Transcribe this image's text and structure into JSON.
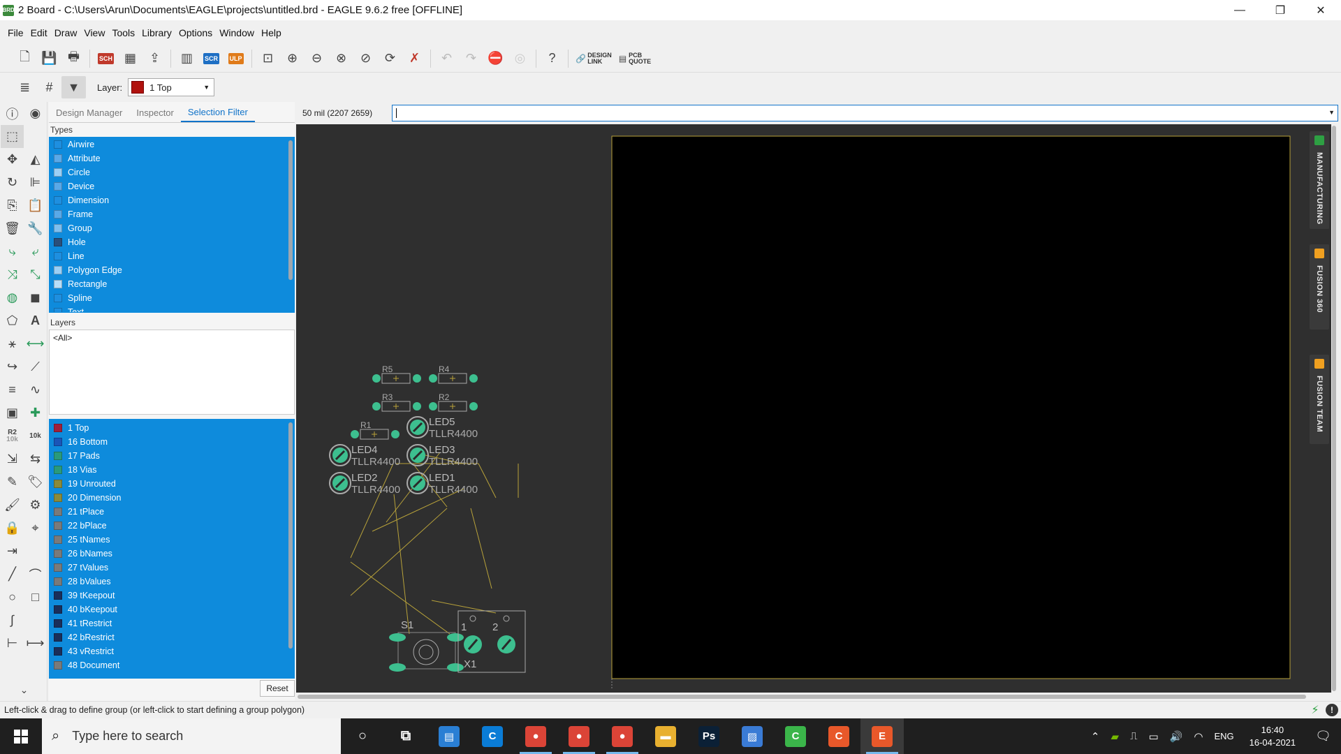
{
  "window": {
    "title": "2 Board - C:\\Users\\Arun\\Documents\\EAGLE\\projects\\untitled.brd - EAGLE 9.6.2 free [OFFLINE]",
    "app_icon_text": "BRD",
    "minimize": "—",
    "restore": "❐",
    "close": "✕"
  },
  "menu": [
    "File",
    "Edit",
    "Draw",
    "View",
    "Tools",
    "Library",
    "Options",
    "Window",
    "Help"
  ],
  "toolbar": {
    "scr_label": "SCR",
    "ulp_label": "ULP",
    "design_link": [
      "DESIGN",
      "LINK"
    ],
    "pcb_quote": [
      "PCB",
      "QUOTE"
    ],
    "help_glyph": "?"
  },
  "layerbar": {
    "label": "Layer:",
    "selected_layer": "1 Top",
    "swatch_color": "#b0120e"
  },
  "tool_labels": {
    "r2": "R2",
    "r2_sub": "10k",
    "val": "10k"
  },
  "panel": {
    "tabs": [
      "Design Manager",
      "Inspector",
      "Selection Filter"
    ],
    "active_tab": "Selection Filter",
    "types_title": "Types",
    "types": [
      {
        "label": "Airwire",
        "color": "#1e8fe0"
      },
      {
        "label": "Attribute",
        "color": "#5aa9e8"
      },
      {
        "label": "Circle",
        "color": "#9bcff5"
      },
      {
        "label": "Device",
        "color": "#5aa9e8"
      },
      {
        "label": "Dimension",
        "color": "#1e8fe0"
      },
      {
        "label": "Frame",
        "color": "#5aa9e8"
      },
      {
        "label": "Group",
        "color": "#7fbfee"
      },
      {
        "label": "Hole",
        "color": "#2a4f7a"
      },
      {
        "label": "Line",
        "color": "#1e8fe0"
      },
      {
        "label": "Polygon Edge",
        "color": "#9bcff5"
      },
      {
        "label": "Rectangle",
        "color": "#b9def8"
      },
      {
        "label": "Spline",
        "color": "#1e8fe0"
      },
      {
        "label": "Text",
        "color": "#1e8fe0"
      }
    ],
    "layers_title": "Layers",
    "layers_filter_value": "<All>",
    "layers": [
      {
        "label": "1 Top",
        "color": "#a0203a"
      },
      {
        "label": "16 Bottom",
        "color": "#1a55b8"
      },
      {
        "label": "17 Pads",
        "color": "#2a9a7a"
      },
      {
        "label": "18 Vias",
        "color": "#2a9a7a"
      },
      {
        "label": "19 Unrouted",
        "color": "#8b8a3a"
      },
      {
        "label": "20 Dimension",
        "color": "#8b8a3a"
      },
      {
        "label": "21 tPlace",
        "color": "#7a7a7a"
      },
      {
        "label": "22 bPlace",
        "color": "#7a7a7a"
      },
      {
        "label": "25 tNames",
        "color": "#7a7a7a"
      },
      {
        "label": "26 bNames",
        "color": "#7a7a7a"
      },
      {
        "label": "27 tValues",
        "color": "#7a7a7a"
      },
      {
        "label": "28 bValues",
        "color": "#7a7a7a"
      },
      {
        "label": "39 tKeepout",
        "color": "#1a2e5a"
      },
      {
        "label": "40 bKeepout",
        "color": "#1a2e5a"
      },
      {
        "label": "41 tRestrict",
        "color": "#1a2e5a"
      },
      {
        "label": "42 bRestrict",
        "color": "#1a2e5a"
      },
      {
        "label": "43 vRestrict",
        "color": "#1a2e5a"
      },
      {
        "label": "48 Document",
        "color": "#7a7a7a"
      }
    ],
    "reset_label": "Reset"
  },
  "coordinates": "50 mil (2207 2659)",
  "command_value": "",
  "board": {
    "parts": [
      {
        "name": "R5"
      },
      {
        "name": "R4"
      },
      {
        "name": "R3"
      },
      {
        "name": "R2"
      },
      {
        "name": "R1"
      },
      {
        "name": "LED5",
        "value": "TLLR4400"
      },
      {
        "name": "LED4",
        "value": "TLLR4400"
      },
      {
        "name": "LED3",
        "value": "TLLR4400"
      },
      {
        "name": "LED2",
        "value": "TLLR4400"
      },
      {
        "name": "LED1",
        "value": "TLLR4400"
      },
      {
        "name": "S1"
      },
      {
        "name": "X1",
        "pin1": "1",
        "pin2": "2"
      }
    ]
  },
  "side_tabs": [
    {
      "label": "MANUFACTURING",
      "color": "#2ea043"
    },
    {
      "label": "FUSION 360",
      "color": "#f0a020"
    },
    {
      "label": "FUSION TEAM",
      "color": "#f0a020"
    }
  ],
  "status": {
    "message": "Left-click & drag to define group (or left-click to start defining a group polygon)"
  },
  "taskbar": {
    "search_placeholder": "Type here to search",
    "apps": [
      {
        "name": "cortana",
        "glyph": "○",
        "color": "transparent"
      },
      {
        "name": "task-view",
        "glyph": "⧉",
        "color": "transparent"
      },
      {
        "name": "file-explorer-card",
        "glyph": "▤",
        "color": "#2a7fd4"
      },
      {
        "name": "skype",
        "glyph": "C",
        "color": "#0a7cd6"
      },
      {
        "name": "chrome-1",
        "glyph": "●",
        "color": "#db4437"
      },
      {
        "name": "chrome-2",
        "glyph": "●",
        "color": "#db4437"
      },
      {
        "name": "chrome-3",
        "glyph": "●",
        "color": "#db4437"
      },
      {
        "name": "folder",
        "glyph": "▬",
        "color": "#e8b030"
      },
      {
        "name": "photoshop",
        "glyph": "Ps",
        "color": "#0b2036"
      },
      {
        "name": "photos",
        "glyph": "▨",
        "color": "#3a7bd5"
      },
      {
        "name": "camtasia-green",
        "glyph": "C",
        "color": "#3bb54a"
      },
      {
        "name": "camtasia-orange",
        "glyph": "C",
        "color": "#e8582a"
      },
      {
        "name": "eagle",
        "glyph": "E",
        "color": "#e8582a"
      }
    ],
    "language": "ENG",
    "time": "16:40",
    "date": "16-04-2021"
  }
}
